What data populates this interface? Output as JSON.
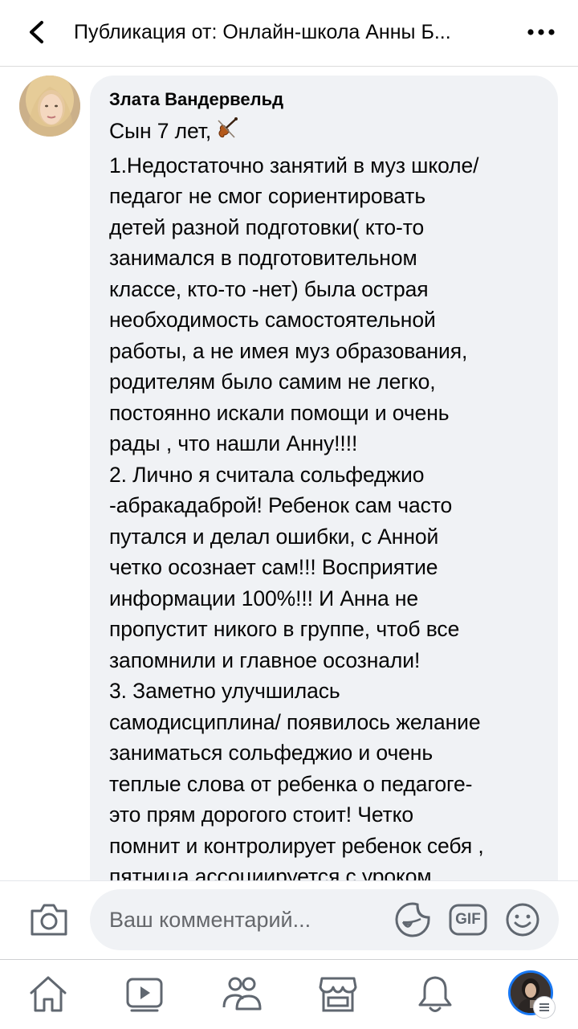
{
  "header": {
    "title": "Публикация от: Онлайн-школа Анны Б...",
    "back_icon": "chevron-left-icon",
    "more_icon": "more-horizontal-icon"
  },
  "comment": {
    "author": "Злата Вандервельд",
    "first_line": "Сын 7 лет,",
    "emoji": "violin-icon",
    "body": "1.Недостаточно занятий в муз школе/\nпедагог не смог сориентировать\nдетей разной подготовки( кто-то\nзанимался в подготовительном\nклассе, кто-то -нет) была острая\nнеобходимость самостоятельной\nработы, а не имея муз образования,\nродителям было самим не легко,\nпостоянно искали помощи и очень\nрады , что нашли Анну!!!!\n2. Лично я считала сольфеджио\n-абракадаброй! Ребенок сам часто\nпутался и делал ошибки, с Анной\nчетко осознает сам!!! Восприятие\nинформации 100%!!! И Анна не\nпропустит никого в группе, чтоб все\nзапомнили и главное осознали!\n3. Заметно улучшилась\nсамодисциплина/ появилось желание\nзаниматься сольфеджио и очень\nтеплые слова от ребенка о педагоге-\nэто прям дорогого стоит! Четко\nпомнит и контролирует ребенок себя ,\nпятница ассоциируется с уроком"
  },
  "composer": {
    "placeholder": "Ваш комментарий...",
    "camera_icon": "camera-icon",
    "sticker_icon": "sticker-icon",
    "gif_label": "GIF",
    "emoji_icon": "smiley-icon"
  },
  "tabbar": {
    "items": [
      "home-icon",
      "video-icon",
      "groups-icon",
      "marketplace-icon",
      "notifications-icon",
      "profile-menu"
    ]
  },
  "colors": {
    "bubble": "#f0f2f5",
    "profile_ring": "#1877f2",
    "secondary_text": "#65676b"
  }
}
